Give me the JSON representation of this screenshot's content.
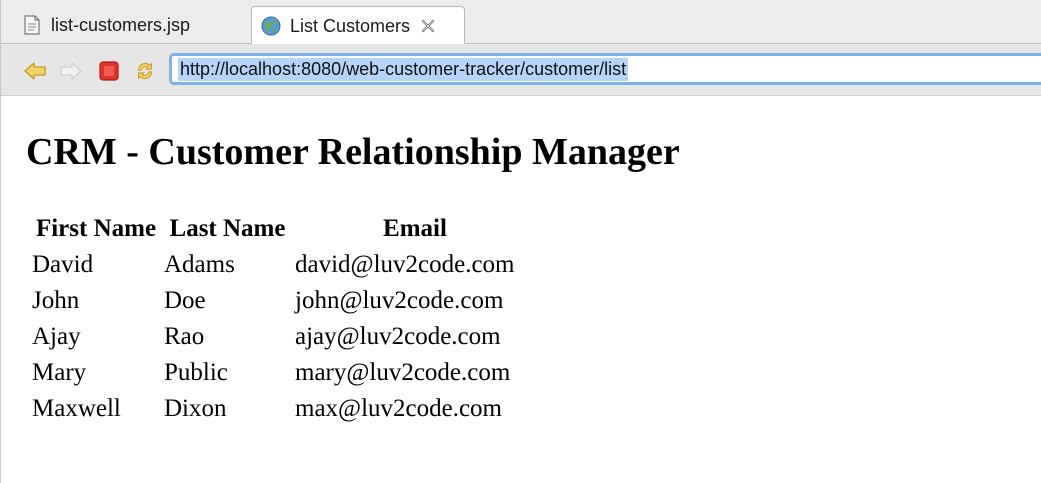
{
  "tabs": [
    {
      "label": "list-customers.jsp",
      "icon": "jsp-file-icon",
      "active": false
    },
    {
      "label": "List Customers",
      "icon": "globe-icon",
      "active": true
    }
  ],
  "toolbar": {
    "back_icon": "back-arrow-icon",
    "forward_icon": "forward-arrow-icon",
    "stop_icon": "stop-icon",
    "refresh_icon": "refresh-icon",
    "url": "http://localhost:8080/web-customer-tracker/customer/list"
  },
  "page": {
    "title": "CRM - Customer Relationship Manager",
    "table": {
      "headers": [
        "First Name",
        "Last Name",
        "Email"
      ],
      "rows": [
        [
          "David",
          "Adams",
          "david@luv2code.com"
        ],
        [
          "John",
          "Doe",
          "john@luv2code.com"
        ],
        [
          "Ajay",
          "Rao",
          "ajay@luv2code.com"
        ],
        [
          "Mary",
          "Public",
          "mary@luv2code.com"
        ],
        [
          "Maxwell",
          "Dixon",
          "max@luv2code.com"
        ]
      ]
    }
  },
  "colors": {
    "url_focus_border": "#7fb2e8",
    "url_selection": "#b5d4f7",
    "stop_red": "#e0322b"
  }
}
